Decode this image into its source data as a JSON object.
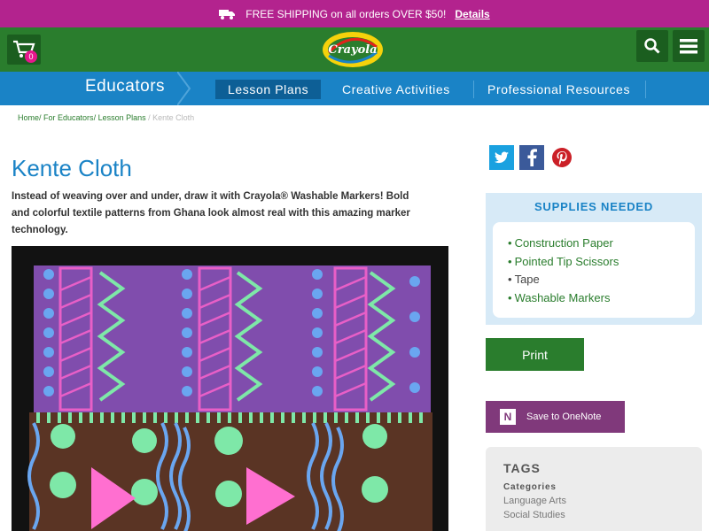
{
  "promo": {
    "text": "FREE SHIPPING on all orders OVER $50!",
    "link": "Details"
  },
  "header": {
    "cart_count": "0",
    "logo": "Crayola"
  },
  "nav": {
    "section": "Educators",
    "tabs": [
      {
        "label": "Lesson Plans"
      },
      {
        "label": "Creative Activities"
      },
      {
        "label": "Professional Resources"
      }
    ]
  },
  "breadcrumb": {
    "items": [
      "Home",
      "For Educators",
      "Lesson Plans"
    ],
    "current": "Kente Cloth"
  },
  "page": {
    "title": "Kente Cloth",
    "description": "Instead of weaving over and under, draw it with Crayola® Washable Markers! Bold and colorful textile patterns from Ghana look almost real with this amazing marker technology."
  },
  "social": {
    "twitter": "twitter-icon",
    "facebook": "facebook-icon",
    "pinterest": "pinterest-icon"
  },
  "supplies": {
    "heading": "SUPPLIES NEEDED",
    "items": [
      {
        "label": "Construction Paper",
        "link": true
      },
      {
        "label": "Pointed Tip Scissors",
        "link": true
      },
      {
        "label": "Tape",
        "link": false
      },
      {
        "label": "Washable Markers",
        "link": true
      }
    ]
  },
  "actions": {
    "print": "Print",
    "onenote": "Save to OneNote"
  },
  "tags": {
    "heading": "TAGS",
    "category_label": "Categories",
    "items": [
      "Language Arts",
      "Social Studies"
    ]
  },
  "colors": {
    "promo_bar": "#b3238e",
    "header": "#2a7d2d",
    "nav": "#1a83c6",
    "title": "#1a83c6",
    "print": "#2a7d2d",
    "onenote": "#80397b"
  }
}
